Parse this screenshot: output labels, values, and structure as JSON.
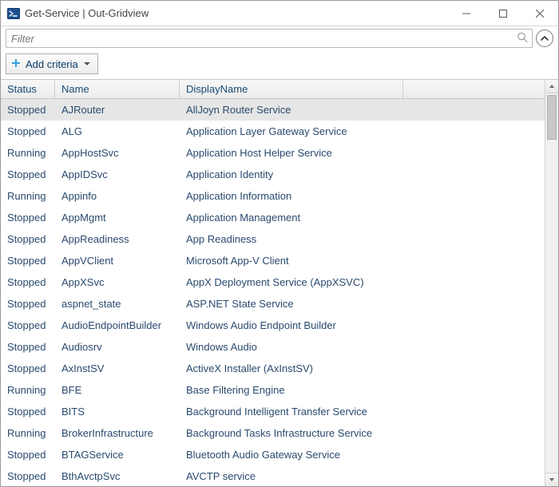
{
  "window": {
    "title": "Get-Service | Out-Gridview"
  },
  "filter": {
    "placeholder": "Filter",
    "value": ""
  },
  "criteria": {
    "add_label": "Add criteria"
  },
  "grid": {
    "columns": {
      "status": "Status",
      "name": "Name",
      "display": "DisplayName"
    },
    "rows": [
      {
        "status": "Stopped",
        "name": "AJRouter",
        "display": "AllJoyn Router Service",
        "selected": true
      },
      {
        "status": "Stopped",
        "name": "ALG",
        "display": "Application Layer Gateway Service"
      },
      {
        "status": "Running",
        "name": "AppHostSvc",
        "display": "Application Host Helper Service"
      },
      {
        "status": "Stopped",
        "name": "AppIDSvc",
        "display": "Application Identity"
      },
      {
        "status": "Running",
        "name": "Appinfo",
        "display": "Application Information"
      },
      {
        "status": "Stopped",
        "name": "AppMgmt",
        "display": "Application Management"
      },
      {
        "status": "Stopped",
        "name": "AppReadiness",
        "display": "App Readiness"
      },
      {
        "status": "Stopped",
        "name": "AppVClient",
        "display": "Microsoft App-V Client"
      },
      {
        "status": "Stopped",
        "name": "AppXSvc",
        "display": "AppX Deployment Service (AppXSVC)"
      },
      {
        "status": "Stopped",
        "name": "aspnet_state",
        "display": "ASP.NET State Service"
      },
      {
        "status": "Stopped",
        "name": "AudioEndpointBuilder",
        "display": "Windows Audio Endpoint Builder"
      },
      {
        "status": "Stopped",
        "name": "Audiosrv",
        "display": "Windows Audio"
      },
      {
        "status": "Stopped",
        "name": "AxInstSV",
        "display": "ActiveX Installer (AxInstSV)"
      },
      {
        "status": "Running",
        "name": "BFE",
        "display": "Base Filtering Engine"
      },
      {
        "status": "Stopped",
        "name": "BITS",
        "display": "Background Intelligent Transfer Service"
      },
      {
        "status": "Running",
        "name": "BrokerInfrastructure",
        "display": "Background Tasks Infrastructure Service"
      },
      {
        "status": "Stopped",
        "name": "BTAGService",
        "display": "Bluetooth Audio Gateway Service"
      },
      {
        "status": "Stopped",
        "name": "BthAvctpSvc",
        "display": "AVCTP service"
      }
    ]
  }
}
